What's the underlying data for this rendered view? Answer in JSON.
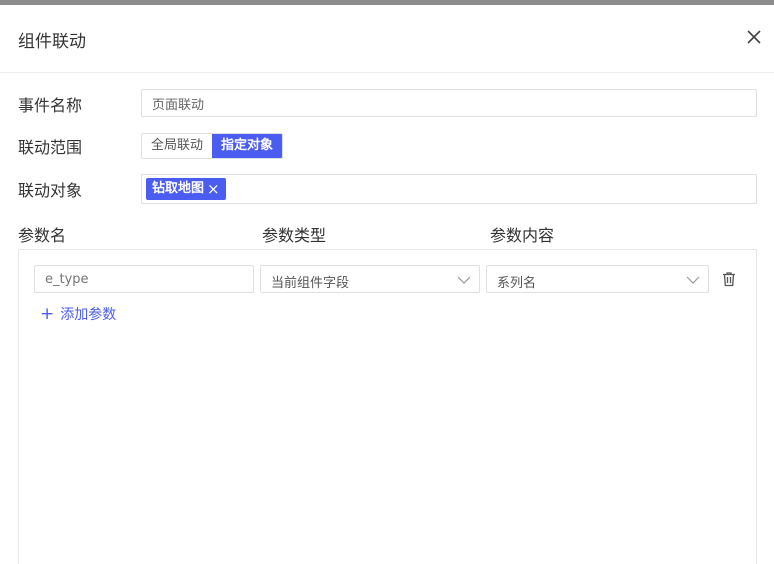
{
  "dialog": {
    "title": "组件联动"
  },
  "form": {
    "event_name": {
      "label": "事件名称",
      "value": "页面联动"
    },
    "scope": {
      "label": "联动范围",
      "options": [
        "全局联动",
        "指定对象"
      ],
      "selected": "指定对象"
    },
    "target": {
      "label": "联动对象",
      "tags": [
        "钻取地图"
      ]
    }
  },
  "params": {
    "headers": {
      "name": "参数名",
      "type": "参数类型",
      "content": "参数内容"
    },
    "rows": [
      {
        "name_placeholder": "e_type",
        "type": "当前组件字段",
        "content": "系列名"
      }
    ],
    "add_label": "添加参数"
  },
  "colors": {
    "accent": "#4b5cf0",
    "border": "#dcdfe6"
  }
}
